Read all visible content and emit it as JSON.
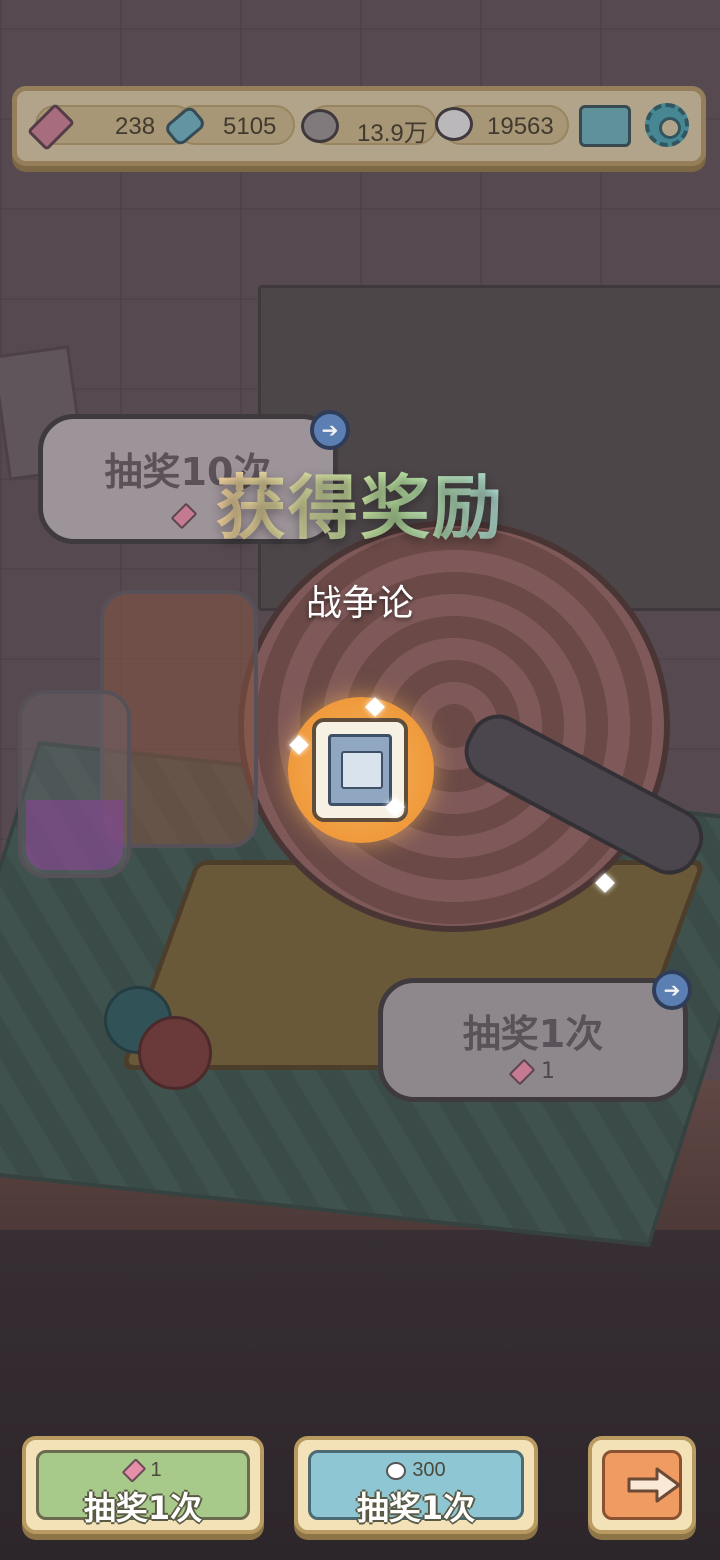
{
  "topbar": {
    "tickets": "238",
    "candies": "5105",
    "grey_bubbles": "13.9万",
    "white_bubbles": "19563"
  },
  "reward": {
    "title": "获得奖励",
    "item_name": "战争论"
  },
  "bubble_left": {
    "title": "抽奖10次"
  },
  "bubble_right": {
    "title": "抽奖1次",
    "cost": "1"
  },
  "bottom": {
    "left_button": {
      "cost": "1",
      "label": "抽奖1次"
    },
    "middle_button": {
      "cost": "300",
      "label": "抽奖1次"
    }
  },
  "icons": {
    "ticket": "ticket-icon",
    "candy": "candy-icon",
    "grey_bubble": "speech-bubble-icon",
    "white_bubble": "ghost-bubble-icon",
    "mail": "mail-icon",
    "settings": "gear-icon",
    "next": "arrow-right-icon",
    "reward": "book-icon"
  },
  "colors": {
    "accent_orange": "#ef9a3c",
    "green_button": "#a7c98a",
    "blue_button": "#8ec6d4",
    "orange_button": "#ef9b61"
  }
}
